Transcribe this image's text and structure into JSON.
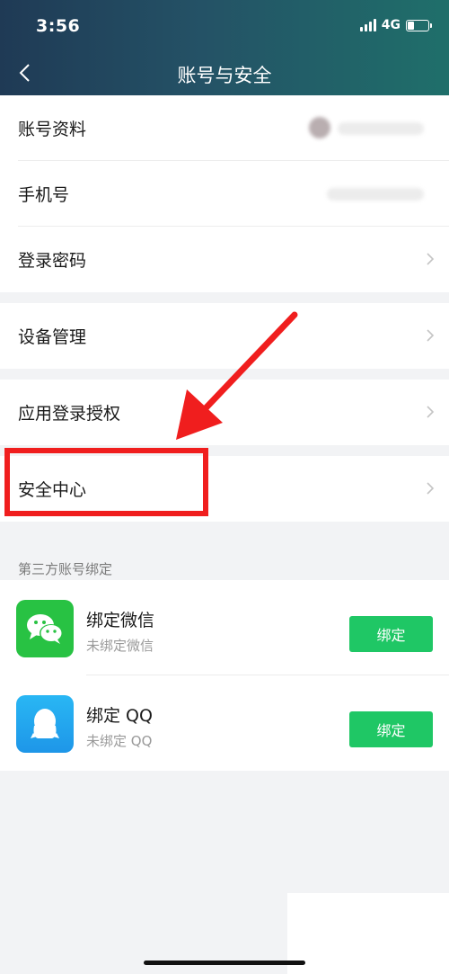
{
  "status": {
    "time": "3:56",
    "network": "4G"
  },
  "nav": {
    "title": "账号与安全"
  },
  "account_rows": [
    {
      "label": "账号资料"
    },
    {
      "label": "手机号"
    },
    {
      "label": "登录密码"
    }
  ],
  "device": {
    "label": "设备管理"
  },
  "authorize": {
    "label": "应用登录授权"
  },
  "security": {
    "label": "安全中心"
  },
  "third_party": {
    "section_title": "第三方账号绑定",
    "items": [
      {
        "name": "绑定微信",
        "status": "未绑定微信",
        "button": "绑定",
        "icon": "wechat-icon"
      },
      {
        "name": "绑定 QQ",
        "status": "未绑定 QQ",
        "button": "绑定",
        "icon": "qq-icon"
      }
    ]
  },
  "colors": {
    "accent_green": "#1fc765",
    "highlight_red": "#f01e1e"
  }
}
